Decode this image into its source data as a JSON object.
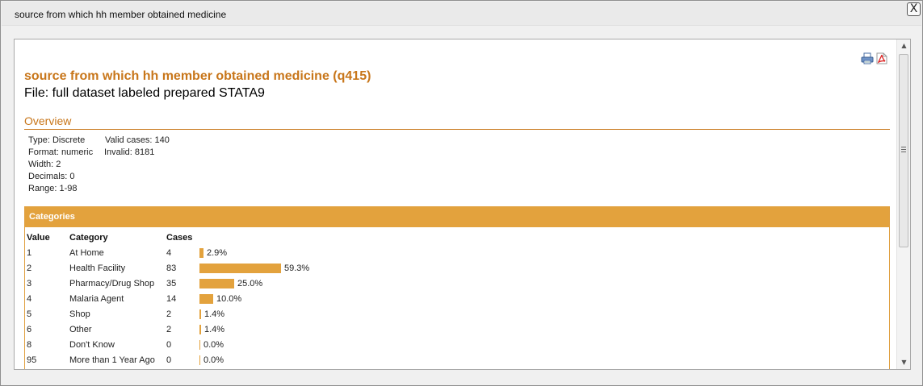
{
  "window": {
    "title": "source from which hh member obtained medicine",
    "close_label": "X"
  },
  "toolbar": {
    "print_icon": "print-icon",
    "pdf_icon": "pdf-icon"
  },
  "variable": {
    "title": "source from which hh member obtained medicine (q415)",
    "file_line": "File: full dataset labeled prepared STATA9"
  },
  "overview": {
    "heading": "Overview",
    "type": "Type: Discrete",
    "format": "Format: numeric",
    "width": "Width: 2",
    "decimals": "Decimals: 0",
    "range": "Range: 1-98",
    "valid_cases": "Valid cases: 140",
    "invalid": "Invalid: 8181"
  },
  "categories": {
    "heading": "Categories",
    "columns": [
      "Value",
      "Category",
      "Cases"
    ],
    "rows": [
      {
        "value": "1",
        "category": "At Home",
        "cases": "4",
        "pct": "2.9%",
        "fraction": 0.029
      },
      {
        "value": "2",
        "category": "Health Facility",
        "cases": "83",
        "pct": "59.3%",
        "fraction": 0.593
      },
      {
        "value": "3",
        "category": "Pharmacy/Drug Shop",
        "cases": "35",
        "pct": "25.0%",
        "fraction": 0.25
      },
      {
        "value": "4",
        "category": "Malaria Agent",
        "cases": "14",
        "pct": "10.0%",
        "fraction": 0.1
      },
      {
        "value": "5",
        "category": "Shop",
        "cases": "2",
        "pct": "1.4%",
        "fraction": 0.014
      },
      {
        "value": "6",
        "category": "Other",
        "cases": "2",
        "pct": "1.4%",
        "fraction": 0.014
      },
      {
        "value": "8",
        "category": "Don't Know",
        "cases": "0",
        "pct": "0.0%",
        "fraction": 0.0
      },
      {
        "value": "95",
        "category": "More than 1 Year Ago",
        "cases": "0",
        "pct": "0.0%",
        "fraction": 0.0
      }
    ]
  },
  "colors": {
    "accent": "#c8761a",
    "bar": "#e3a23d"
  }
}
